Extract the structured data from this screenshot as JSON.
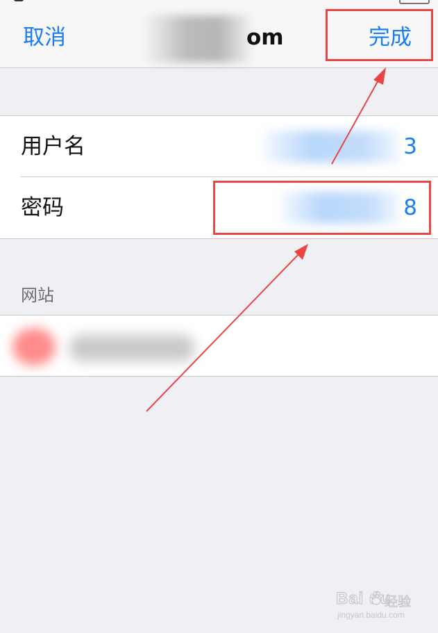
{
  "navbar": {
    "cancel_label": "取消",
    "title_suffix": "om",
    "done_label": "完成"
  },
  "credentials": {
    "username": {
      "label": "用户名",
      "value_suffix": "3"
    },
    "password": {
      "label": "密码",
      "value_suffix": "8"
    }
  },
  "website_section": {
    "header": "网站"
  },
  "watermark": {
    "logo": "Bai  du",
    "text": "经验",
    "url": "jingyan.baidu.com"
  },
  "colors": {
    "accent": "#1a7ef0",
    "annotation": "#e84545",
    "background": "#efeff4"
  },
  "icons": [
    "site-favicon-icon",
    "baidu-paw-icon",
    "arrow-icon"
  ]
}
